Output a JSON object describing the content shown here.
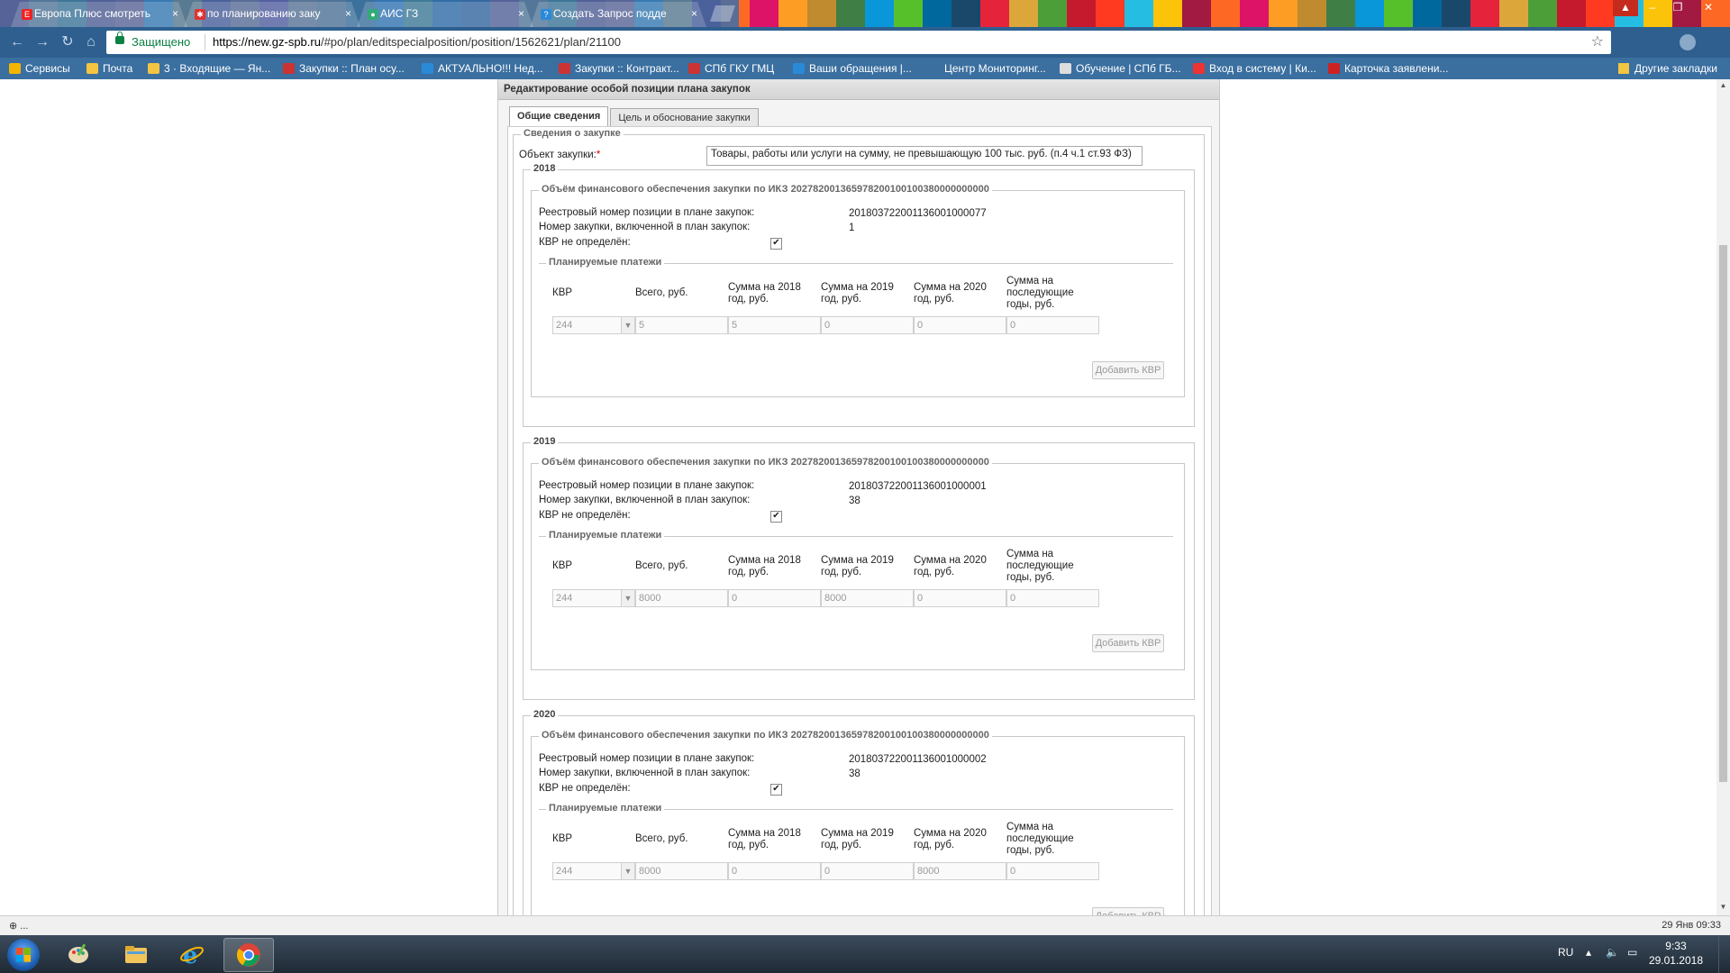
{
  "browser": {
    "tabs": [
      {
        "title": "Европа Плюс смотреть",
        "fav_color": "#e22",
        "fav_text": "E+",
        "active": false
      },
      {
        "title": "по планированию заку",
        "fav_color": "#d33",
        "fav_text": "✱",
        "active": false
      },
      {
        "title": "АИС ГЗ",
        "fav_color": "#3a7",
        "fav_text": "●",
        "active": false
      },
      {
        "title": "Создать Запрос подде",
        "fav_color": "#2a8ad8",
        "fav_text": "?",
        "active": false
      }
    ],
    "close_glyph": "×",
    "secure_label": "Защищено",
    "url_host": "https://new.gz-spb.ru",
    "url_path": "/#po/plan/editspecialposition/position/1562621/plan/21100",
    "bookmarks": [
      {
        "label": "Сервисы",
        "color": "#f4b400"
      },
      {
        "label": "Почта",
        "color": "#f4c542"
      },
      {
        "label": "3 · Входящие — Ян...",
        "color": "#f4c542"
      },
      {
        "label": "Закупки :: План осу...",
        "color": "#c33"
      },
      {
        "label": "АКТУАЛЬНО!!! Нед...",
        "color": "#2a8ad8"
      },
      {
        "label": "Закупки :: Контракт...",
        "color": "#c33"
      },
      {
        "label": "СПб ГКУ ГМЦ",
        "color": "#c33"
      },
      {
        "label": "Ваши обращения |...",
        "color": "#2a8ad8"
      },
      {
        "label": "Центр Мониторинг...",
        "color": "#3a6fa0"
      },
      {
        "label": "Обучение | СПб ГБ...",
        "color": "#ddd"
      },
      {
        "label": "Вход в систему | Ки...",
        "color": "#e33"
      },
      {
        "label": "Карточка заявлени...",
        "color": "#c22"
      }
    ],
    "other_bookmarks": "Другие закладки"
  },
  "page": {
    "panel_title": "Редактирование особой позиции плана закупок",
    "tabs": [
      "Общие сведения",
      "Цель и обоснование закупки"
    ],
    "section_title": "Сведения о закупке",
    "object_label": "Объект закупки:",
    "required_mark": "*",
    "object_value": "Товары, работы или услуги на сумму, не превышающую 100 тыс. руб. (п.4 ч.1 ст.93 ФЗ)",
    "labels": {
      "reg_number": "Реестровый номер позиции в плане закупок:",
      "purchase_number": "Номер закупки, включенной в план закупок:",
      "kvr_undefined": "КВР не определён:",
      "planned_payments": "Планируемые платежи",
      "add_kvr": "Добавить КВР",
      "col_kvr": "КВР",
      "col_total": "Всего, руб.",
      "col_2018": "Сумма на 2018 год, руб.",
      "col_2019": "Сумма на 2019 год, руб.",
      "col_2020": "Сумма на 2020 год, руб.",
      "col_later": "Сумма на последующие годы, руб."
    },
    "years": [
      {
        "year": "2018",
        "funding_title": "Объём финансового обеспечения закупки по ИКЗ 202782001365978200100100380000000000",
        "reg_number": "201803722001136001000077",
        "purchase_number": "1",
        "kvr_checked": "✔",
        "row": {
          "kvr": "244",
          "total": "5",
          "y2018": "5",
          "y2019": "0",
          "y2020": "0",
          "later": "0"
        }
      },
      {
        "year": "2019",
        "funding_title": "Объём финансового обеспечения закупки по ИКЗ 202782001365978200100100380000000000",
        "reg_number": "201803722001136001000001",
        "purchase_number": "38",
        "kvr_checked": "✔",
        "row": {
          "kvr": "244",
          "total": "8000",
          "y2018": "0",
          "y2019": "8000",
          "y2020": "0",
          "later": "0"
        }
      },
      {
        "year": "2020",
        "funding_title": "Объём финансового обеспечения закупки по ИКЗ 202782001365978200100100380000000000",
        "reg_number": "201803722001136001000002",
        "purchase_number": "38",
        "kvr_checked": "✔",
        "row": {
          "kvr": "244",
          "total": "8000",
          "y2018": "0",
          "y2019": "0",
          "y2020": "8000",
          "later": "0"
        }
      }
    ]
  },
  "statusbar": {
    "left": "⊕ ...",
    "right": "29 Янв 09:33"
  },
  "taskbar": {
    "lang": "RU",
    "time": "9:33",
    "date": "29.01.2018"
  }
}
